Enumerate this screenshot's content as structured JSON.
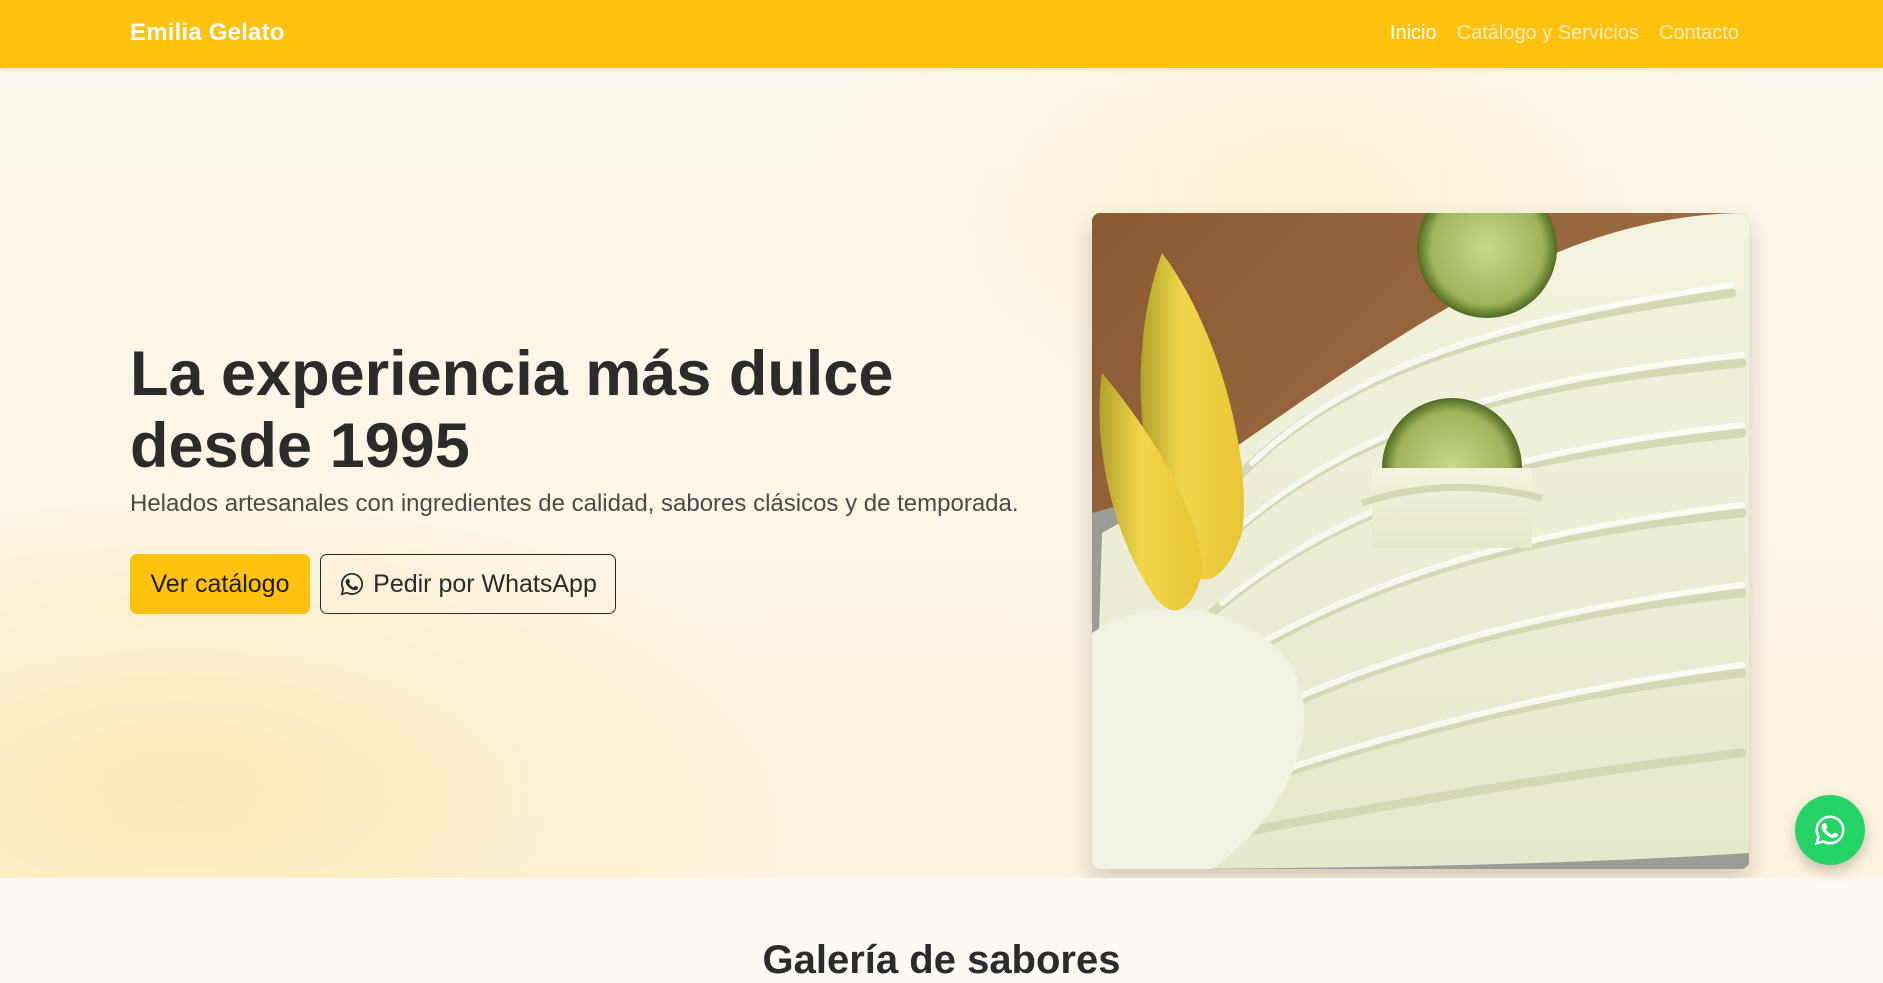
{
  "navbar": {
    "brand": "Emilia Gelato",
    "links": [
      {
        "label": "Inicio",
        "active": true
      },
      {
        "label": "Catálogo y Servicios",
        "active": false
      },
      {
        "label": "Contacto",
        "active": false
      }
    ]
  },
  "hero": {
    "title": "La experiencia más dulce desde 1995",
    "subtitle": "Helados artesanales con ingredientes de calidad, sabores clásicos y de temporada.",
    "catalog_button": "Ver catálogo",
    "whatsapp_button": "Pedir por WhatsApp",
    "image_icon": "gelato-photo"
  },
  "gallery": {
    "title": "Galería de sabores"
  },
  "floating": {
    "icon": "whatsapp-icon"
  },
  "colors": {
    "brand_yellow": "#ffc20e",
    "whatsapp_green": "#25d366",
    "text_dark": "#2b2b2b"
  }
}
